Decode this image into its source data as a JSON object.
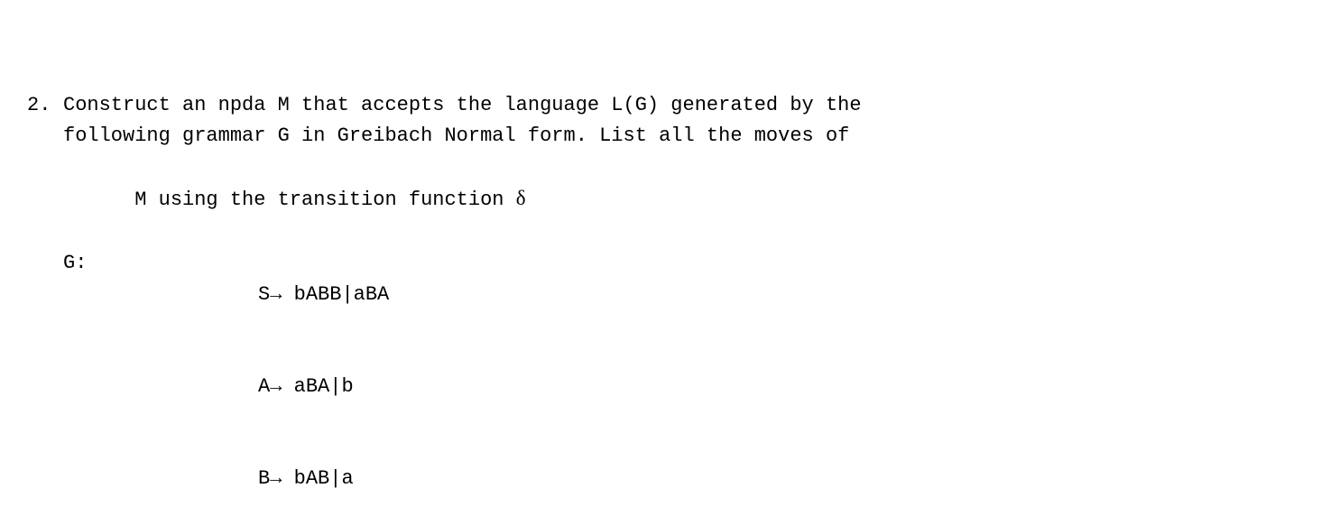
{
  "problem": {
    "number": "2.",
    "intro_line1": "Construct an npda M that accepts the language L(G) generated by the",
    "intro_line2": "following grammar G in Greibach Normal form. List all the moves of",
    "intro_line3_prefix": "M using the transition function ",
    "delta": "δ",
    "grammar": {
      "label": "G:",
      "rules": [
        {
          "lhs": "S",
          "arrow": "→",
          "rhs": " bABB|aBA"
        },
        {
          "lhs": "A",
          "arrow": "→",
          "rhs": " aBA|b"
        },
        {
          "lhs": "B",
          "arrow": "→",
          "rhs": " bAB|a"
        }
      ]
    }
  }
}
